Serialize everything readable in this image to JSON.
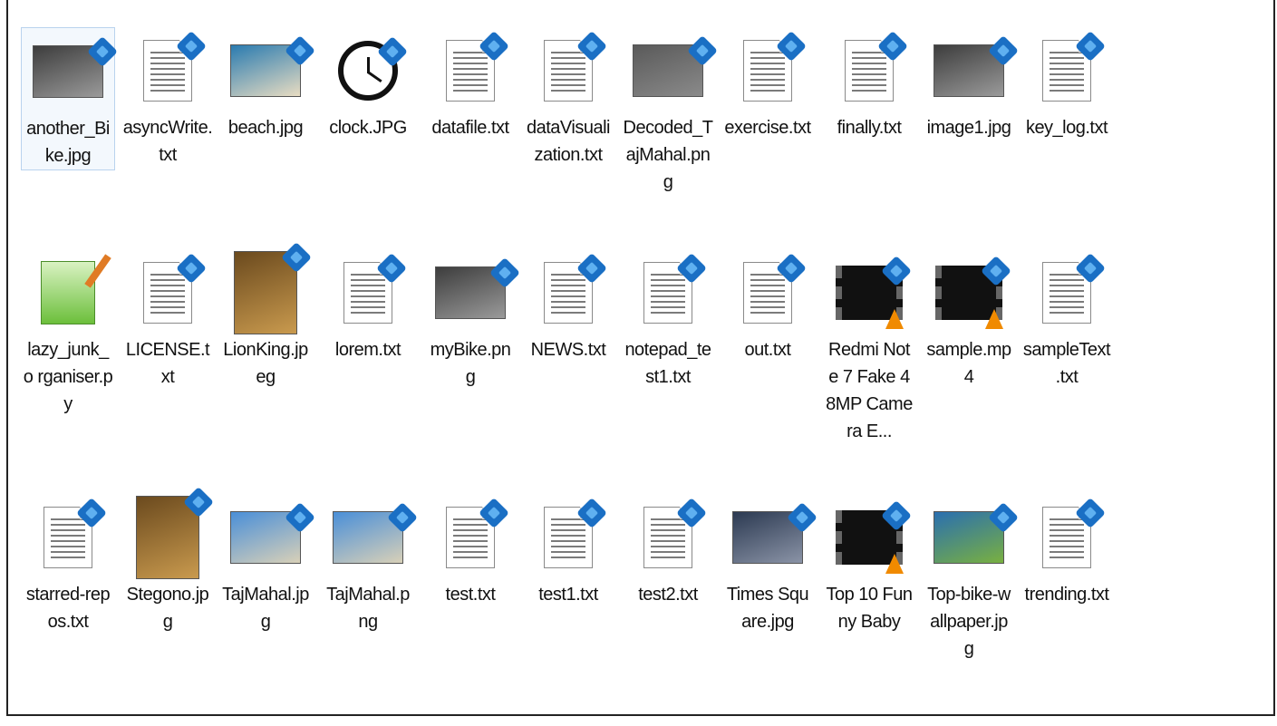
{
  "files": [
    {
      "name": "another_Bi ke.jpg",
      "icon": "photo-bike-icon",
      "kind": "photo",
      "selected": true,
      "colors": [
        "#3d3d3d",
        "#9a9a9a"
      ]
    },
    {
      "name": "asyncWrite. txt",
      "icon": "text-file-icon",
      "kind": "doc"
    },
    {
      "name": "beach.jpg",
      "icon": "photo-beach-icon",
      "kind": "photo",
      "colors": [
        "#2a7bb0",
        "#e8dcc2"
      ]
    },
    {
      "name": "clock.JPG",
      "icon": "clock-icon",
      "kind": "clock"
    },
    {
      "name": "datafile.txt",
      "icon": "text-file-icon",
      "kind": "doc"
    },
    {
      "name": "dataVisuali zation.txt",
      "icon": "text-file-icon",
      "kind": "doc"
    },
    {
      "name": "Decoded_T ajMahal.pn g",
      "icon": "photo-noise-icon",
      "kind": "photo",
      "colors": [
        "#5a5a5a",
        "#8a8a8a"
      ]
    },
    {
      "name": "exercise.txt",
      "icon": "text-file-icon",
      "kind": "doc"
    },
    {
      "name": "finally.txt",
      "icon": "text-file-icon",
      "kind": "doc"
    },
    {
      "name": "image1.jpg",
      "icon": "photo-bike-icon",
      "kind": "photo",
      "colors": [
        "#3d3d3d",
        "#9a9a9a"
      ]
    },
    {
      "name": "key_log.txt",
      "icon": "text-file-icon",
      "kind": "doc"
    },
    {
      "name": "lazy_junk_o rganiser.py",
      "icon": "python-file-icon",
      "kind": "py"
    },
    {
      "name": "LICENSE.txt",
      "icon": "text-file-icon",
      "kind": "doc"
    },
    {
      "name": "LionKing.jp eg",
      "icon": "photo-lion-icon",
      "kind": "tall",
      "colors": [
        "#6b4a1e",
        "#c99a4e"
      ]
    },
    {
      "name": "lorem.txt",
      "icon": "text-file-icon",
      "kind": "doc"
    },
    {
      "name": "myBike.pn g",
      "icon": "photo-bike-icon",
      "kind": "photo",
      "colors": [
        "#3d3d3d",
        "#9a9a9a"
      ]
    },
    {
      "name": "NEWS.txt",
      "icon": "text-file-icon",
      "kind": "doc"
    },
    {
      "name": "notepad_te st1.txt",
      "icon": "text-file-icon",
      "kind": "doc"
    },
    {
      "name": "out.txt",
      "icon": "text-file-icon",
      "kind": "doc"
    },
    {
      "name": "Redmi Note 7 Fake 48MP Camera E...",
      "icon": "video-file-icon",
      "kind": "film"
    },
    {
      "name": "sample.mp 4",
      "icon": "video-file-icon",
      "kind": "film"
    },
    {
      "name": "sampleText .txt",
      "icon": "text-file-icon",
      "kind": "doc"
    },
    {
      "name": "starred-rep os.txt",
      "icon": "text-file-icon",
      "kind": "doc"
    },
    {
      "name": "Stegono.jp g",
      "icon": "photo-lion-icon",
      "kind": "tall",
      "colors": [
        "#6b4a1e",
        "#c99a4e"
      ]
    },
    {
      "name": "TajMahal.jp g",
      "icon": "photo-tajmahal-icon",
      "kind": "photo",
      "colors": [
        "#4a8fd8",
        "#d8d0b8"
      ]
    },
    {
      "name": "TajMahal.p ng",
      "icon": "photo-tajmahal-icon",
      "kind": "photo",
      "colors": [
        "#4a8fd8",
        "#d8d0b8"
      ]
    },
    {
      "name": "test.txt",
      "icon": "text-file-icon",
      "kind": "doc"
    },
    {
      "name": "test1.txt",
      "icon": "text-file-icon",
      "kind": "doc"
    },
    {
      "name": "test2.txt",
      "icon": "text-file-icon",
      "kind": "doc"
    },
    {
      "name": "Times Square.jpg",
      "icon": "photo-city-icon",
      "kind": "photo",
      "colors": [
        "#2c3a52",
        "#8a93a6"
      ]
    },
    {
      "name": "Top 10 Funny Baby",
      "icon": "video-file-icon",
      "kind": "film"
    },
    {
      "name": "Top-bike-w allpaper.jp g",
      "icon": "photo-bike-icon",
      "kind": "photo",
      "colors": [
        "#2a6fb0",
        "#79b040"
      ]
    },
    {
      "name": "trending.txt",
      "icon": "text-file-icon",
      "kind": "doc"
    }
  ]
}
